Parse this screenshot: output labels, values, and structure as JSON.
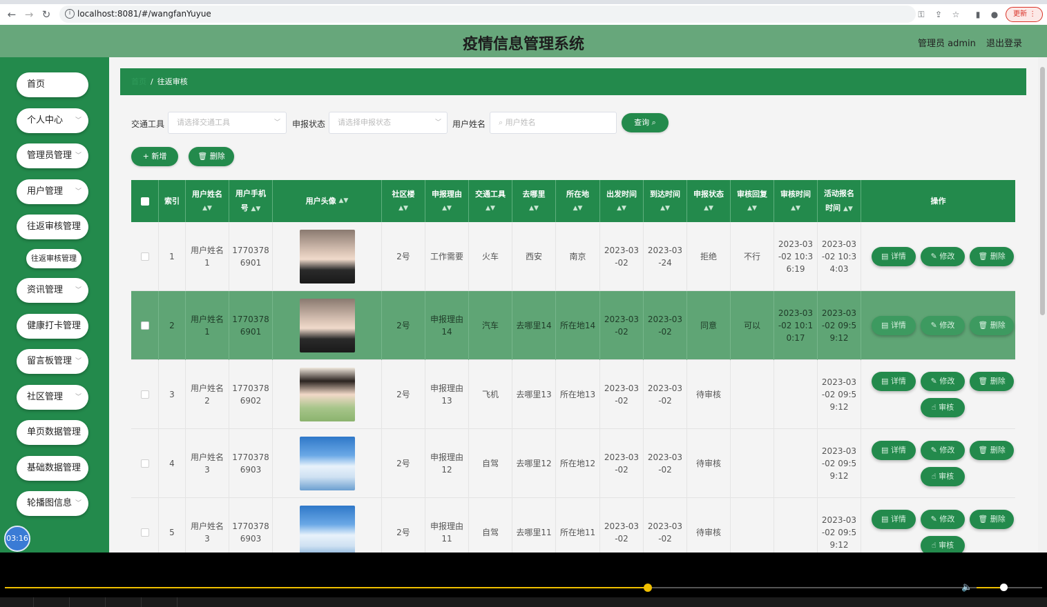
{
  "browser": {
    "url": "localhost:8081/#/wangfanYuyue",
    "update_label": "更新"
  },
  "header": {
    "title": "疫情信息管理系统",
    "admin": "管理员 admin",
    "logout": "退出登录"
  },
  "sidebar": {
    "items": [
      {
        "label": "首页"
      },
      {
        "label": "个人中心"
      },
      {
        "label": "管理员管理"
      },
      {
        "label": "用户管理"
      },
      {
        "label": "往返审核管理"
      },
      {
        "label": "往返审核管理"
      },
      {
        "label": "资讯管理"
      },
      {
        "label": "健康打卡管理"
      },
      {
        "label": "留言板管理"
      },
      {
        "label": "社区管理"
      },
      {
        "label": "单页数据管理"
      },
      {
        "label": "基础数据管理"
      },
      {
        "label": "轮播图信息"
      }
    ],
    "clock": "03:16"
  },
  "breadcrumb": {
    "home": "首页",
    "current": "往返审核"
  },
  "filters": {
    "transport_label": "交通工具",
    "transport_placeholder": "请选择交通工具",
    "status_label": "申报状态",
    "status_placeholder": "请选择申报状态",
    "username_label": "用户姓名",
    "username_placeholder": "用户姓名",
    "query_label": "查询"
  },
  "actions": {
    "add_label": "新增",
    "delete_label": "删除"
  },
  "table": {
    "headers": {
      "index": "索引",
      "username1": "用户姓名",
      "username2": "",
      "phone1": "用户手机",
      "phone2": "号",
      "avatar": "用户头像",
      "building": "社区楼",
      "reason": "申报理由",
      "transport": "交通工具",
      "dest": "去哪里",
      "location": "所在地",
      "depart": "出发时间",
      "arrive": "到达时间",
      "status": "申报状态",
      "reply": "审核回复",
      "review_time": "审核时间",
      "act1": "活动报名",
      "act2": "时间",
      "ops": "操作"
    },
    "op_labels": {
      "detail": "详情",
      "edit": "修改",
      "delete": "删除",
      "review": "审核"
    },
    "rows": [
      {
        "index": "1",
        "user1": "用户姓名",
        "user2": "1",
        "phone1": "1770378",
        "phone2": "6901",
        "avatar": "girl1",
        "building": "2号",
        "reason1": "工作需要",
        "reason2": "",
        "transport": "火车",
        "dest": "西安",
        "location": "南京",
        "depart1": "2023-03",
        "depart2": "-02",
        "arrive1": "2023-03",
        "arrive2": "-24",
        "status": "拒绝",
        "reply": "不行",
        "rt1": "2023-03",
        "rt2": "-02 10:3",
        "rt3": "6:19",
        "at1": "2023-03",
        "at2": "-02 10:3",
        "at3": "4:03"
      },
      {
        "index": "2",
        "user1": "用户姓名",
        "user2": "1",
        "phone1": "1770378",
        "phone2": "6901",
        "avatar": "girl1",
        "building": "2号",
        "reason1": "申报理由",
        "reason2": "14",
        "transport": "汽车",
        "dest": "去哪里14",
        "location": "所在地14",
        "depart1": "2023-03",
        "depart2": "-02",
        "arrive1": "2023-03",
        "arrive2": "-02",
        "status": "同意",
        "reply": "可以",
        "rt1": "2023-03",
        "rt2": "-02 10:1",
        "rt3": "0:17",
        "at1": "2023-03",
        "at2": "-02 09:5",
        "at3": "9:12"
      },
      {
        "index": "3",
        "user1": "用户姓名",
        "user2": "2",
        "phone1": "1770378",
        "phone2": "6902",
        "avatar": "girl2",
        "building": "2号",
        "reason1": "申报理由",
        "reason2": "13",
        "transport": "飞机",
        "dest": "去哪里13",
        "location": "所在地13",
        "depart1": "2023-03",
        "depart2": "-02",
        "arrive1": "2023-03",
        "arrive2": "-02",
        "status": "待审核",
        "reply": "",
        "rt1": "",
        "rt2": "",
        "rt3": "",
        "at1": "2023-03",
        "at2": "-02 09:5",
        "at3": "9:12"
      },
      {
        "index": "4",
        "user1": "用户姓名",
        "user2": "3",
        "phone1": "1770378",
        "phone2": "6903",
        "avatar": "boy",
        "building": "2号",
        "reason1": "申报理由",
        "reason2": "12",
        "transport": "自驾",
        "dest": "去哪里12",
        "location": "所在地12",
        "depart1": "2023-03",
        "depart2": "-02",
        "arrive1": "2023-03",
        "arrive2": "-02",
        "status": "待审核",
        "reply": "",
        "rt1": "",
        "rt2": "",
        "rt3": "",
        "at1": "2023-03",
        "at2": "-02 09:5",
        "at3": "9:12"
      },
      {
        "index": "5",
        "user1": "用户姓名",
        "user2": "3",
        "phone1": "1770378",
        "phone2": "6903",
        "avatar": "boy",
        "building": "2号",
        "reason1": "申报理由",
        "reason2": "11",
        "transport": "自驾",
        "dest": "去哪里11",
        "location": "所在地11",
        "depart1": "2023-03",
        "depart2": "-02",
        "arrive1": "2023-03",
        "arrive2": "-02",
        "status": "待审核",
        "reply": "",
        "rt1": "",
        "rt2": "",
        "rt3": "",
        "at1": "2023-03",
        "at2": "-02 09:5",
        "at3": "9:12"
      }
    ]
  },
  "colors": {
    "primary": "#238a4c",
    "header": "#67a77b",
    "row_highlight": "#5fa575"
  }
}
